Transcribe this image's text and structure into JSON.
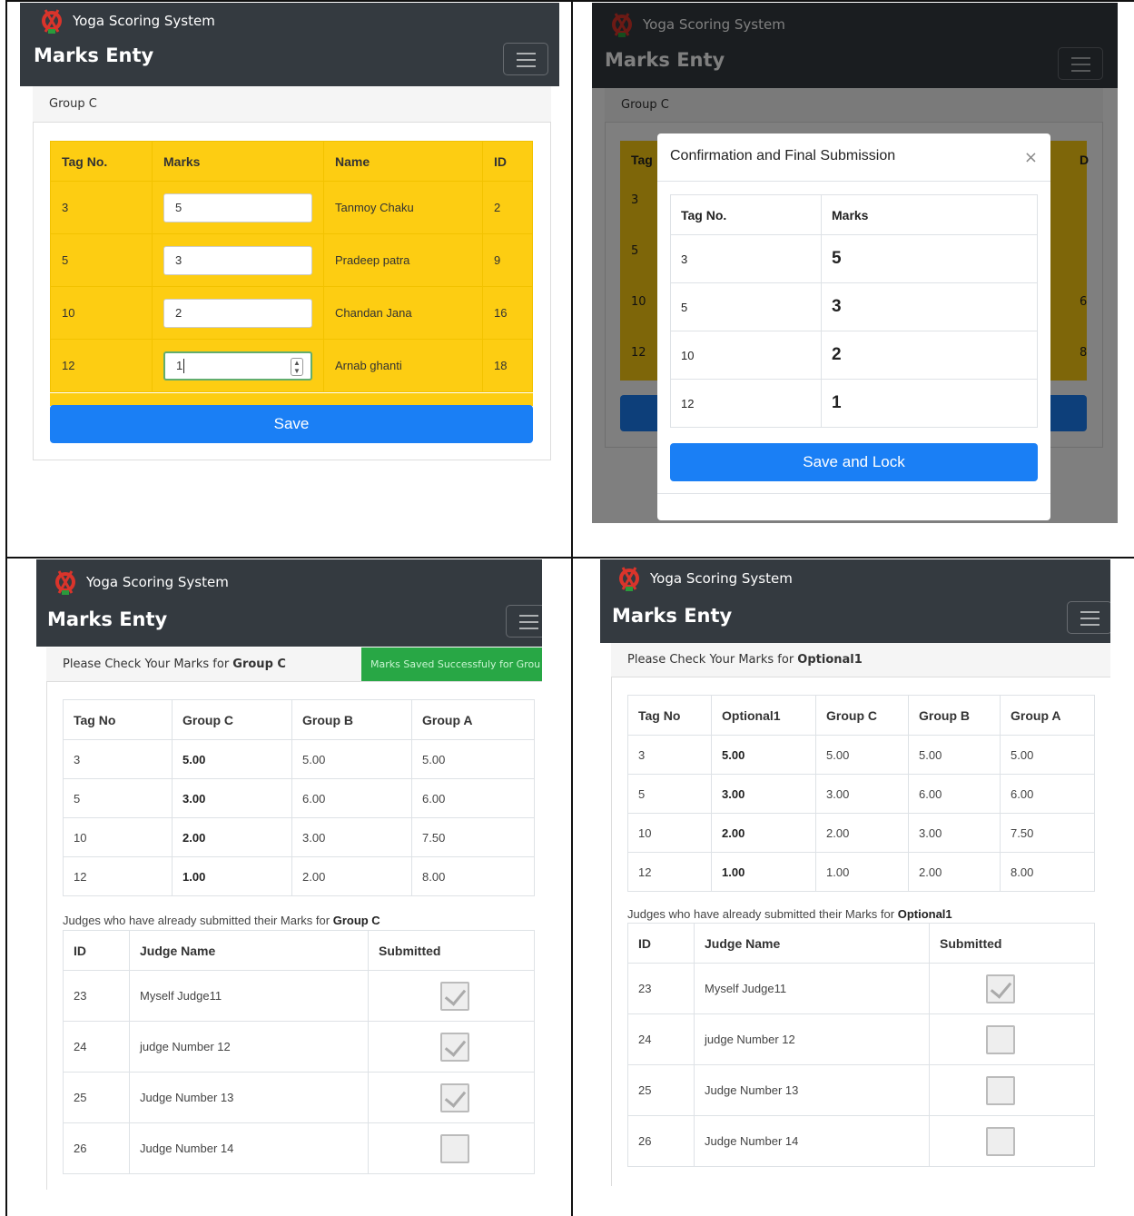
{
  "app": {
    "brand": "Yoga Scoring System",
    "title": "Marks Enty"
  },
  "panel1": {
    "group_label": "Group C",
    "headers": [
      "Tag No.",
      "Marks",
      "Name",
      "ID"
    ],
    "rows": [
      {
        "tag": "3",
        "marks": "5",
        "name": "Tanmoy Chaku",
        "id": "2"
      },
      {
        "tag": "5",
        "marks": "3",
        "name": "Pradeep patra",
        "id": "9"
      },
      {
        "tag": "10",
        "marks": "2",
        "name": "Chandan Jana",
        "id": "16"
      },
      {
        "tag": "12",
        "marks": "1",
        "name": "Arnab ghanti",
        "id": "18"
      }
    ],
    "save_label": "Save"
  },
  "panel2": {
    "group_label": "Group C",
    "bg_headers": [
      "Tag",
      "D"
    ],
    "bg_rows": [
      {
        "tag": "3",
        "id": ""
      },
      {
        "tag": "5",
        "id": ""
      },
      {
        "tag": "10",
        "id": "6"
      },
      {
        "tag": "12",
        "id": "8"
      }
    ],
    "modal_title": "Confirmation and Final Submission",
    "close": "×",
    "headers": [
      "Tag No.",
      "Marks"
    ],
    "rows": [
      {
        "tag": "3",
        "marks": "5"
      },
      {
        "tag": "5",
        "marks": "3"
      },
      {
        "tag": "10",
        "marks": "2"
      },
      {
        "tag": "12",
        "marks": "1"
      }
    ],
    "save_lock_label": "Save and Lock"
  },
  "panel3": {
    "check_prefix": "Please Check Your Marks for ",
    "check_group": "Group C",
    "toast": "Marks Saved Successfuly for Grou",
    "headers": [
      "Tag No",
      "Group C",
      "Group B",
      "Group A"
    ],
    "rows": [
      [
        "3",
        "5.00",
        "5.00",
        "5.00"
      ],
      [
        "5",
        "3.00",
        "6.00",
        "6.00"
      ],
      [
        "10",
        "2.00",
        "3.00",
        "7.50"
      ],
      [
        "12",
        "1.00",
        "2.00",
        "8.00"
      ]
    ],
    "judges_prefix": "Judges who have already submitted their Marks for ",
    "judges_group": "Group C",
    "judge_headers": [
      "ID",
      "Judge Name",
      "Submitted"
    ],
    "judges": [
      {
        "id": "23",
        "name": "Myself Judge11",
        "submitted": true
      },
      {
        "id": "24",
        "name": "judge Number 12",
        "submitted": true
      },
      {
        "id": "25",
        "name": "Judge Number 13",
        "submitted": true
      },
      {
        "id": "26",
        "name": "Judge Number 14",
        "submitted": false
      }
    ]
  },
  "panel4": {
    "check_prefix": "Please Check Your Marks for ",
    "check_group": "Optional1",
    "headers": [
      "Tag No",
      "Optional1",
      "Group C",
      "Group B",
      "Group A"
    ],
    "rows": [
      [
        "3",
        "5.00",
        "5.00",
        "5.00",
        "5.00"
      ],
      [
        "5",
        "3.00",
        "3.00",
        "6.00",
        "6.00"
      ],
      [
        "10",
        "2.00",
        "2.00",
        "3.00",
        "7.50"
      ],
      [
        "12",
        "1.00",
        "1.00",
        "2.00",
        "8.00"
      ]
    ],
    "judges_prefix": "Judges who have already submitted their Marks for ",
    "judges_group": "Optional1",
    "judge_headers": [
      "ID",
      "Judge Name",
      "Submitted"
    ],
    "judges": [
      {
        "id": "23",
        "name": "Myself Judge11",
        "submitted": true
      },
      {
        "id": "24",
        "name": "judge Number 12",
        "submitted": false
      },
      {
        "id": "25",
        "name": "Judge Number 13",
        "submitted": false
      },
      {
        "id": "26",
        "name": "Judge Number 14",
        "submitted": false
      }
    ]
  },
  "colors": {
    "navbar": "#343a40",
    "yellow": "#fdcd12",
    "primary": "#1a7ff5",
    "success": "#28a745"
  }
}
